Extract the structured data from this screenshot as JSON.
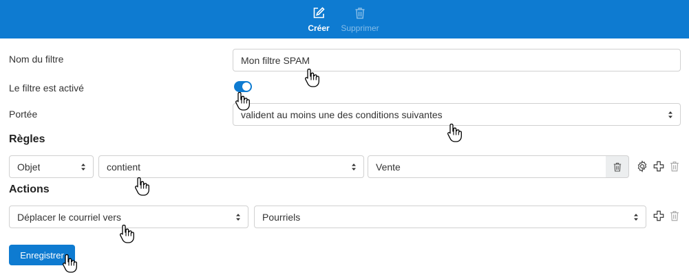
{
  "toolbar": {
    "create_label": "Créer",
    "delete_label": "Supprimer"
  },
  "form": {
    "name_label": "Nom du filtre",
    "name_value": "Mon filtre SPAM",
    "active_label": "Le filtre est activé",
    "active": true,
    "scope_label": "Portée",
    "scope_value": "valident au moins une des conditions suivantes"
  },
  "rules": {
    "heading": "Règles",
    "items": [
      {
        "field": "Objet",
        "operator": "contient",
        "value": "Vente"
      }
    ]
  },
  "actions": {
    "heading": "Actions",
    "items": [
      {
        "action": "Déplacer le courriel vers",
        "target": "Pourriels"
      }
    ]
  },
  "save_label": "Enregistrer",
  "colors": {
    "accent": "#0e7bd1",
    "toolbar_disabled_text": "#86bde8",
    "border": "#d0d0d0"
  }
}
